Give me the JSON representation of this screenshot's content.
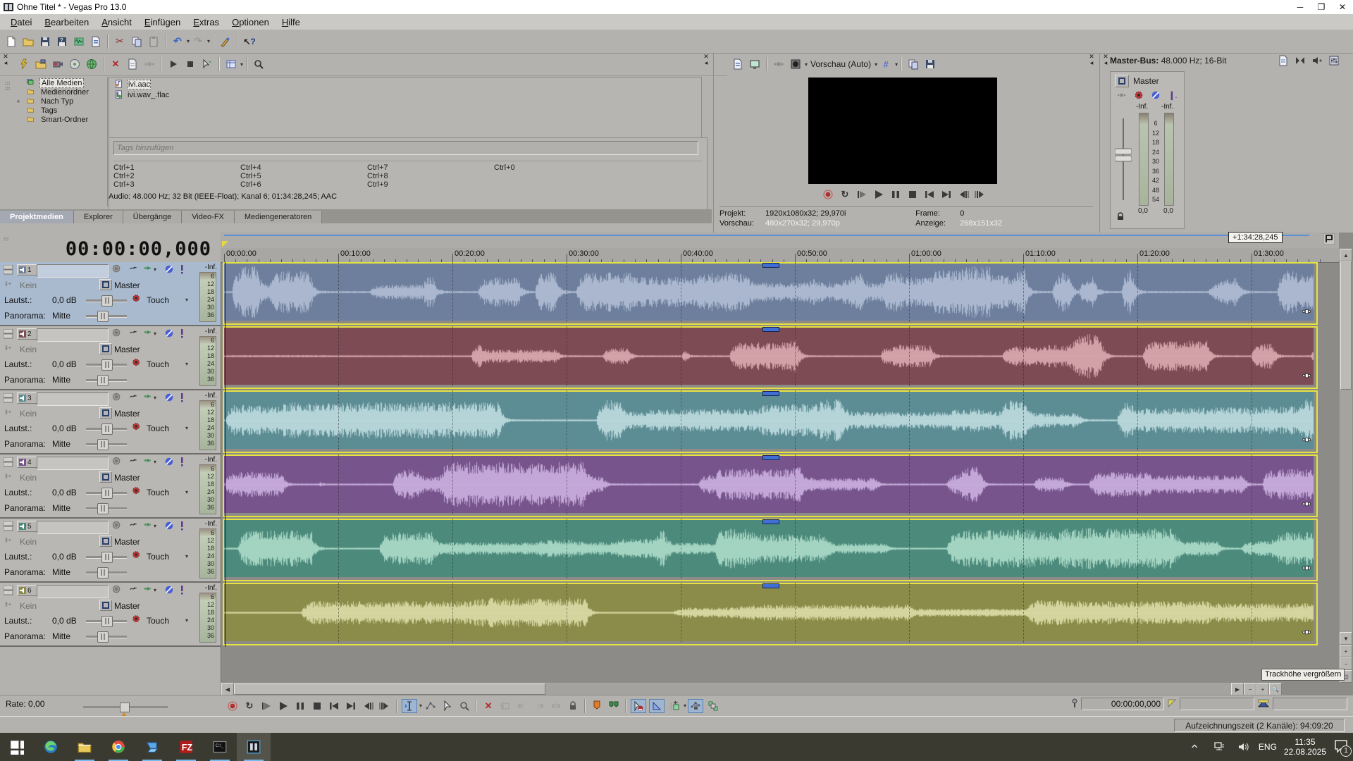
{
  "window": {
    "title": "Ohne Titel * - Vegas Pro 13.0",
    "minimize": "─",
    "maximize": "❐",
    "close": "✕"
  },
  "menu": {
    "items": [
      "Datei",
      "Bearbeiten",
      "Ansicht",
      "Einfügen",
      "Extras",
      "Optionen",
      "Hilfe"
    ]
  },
  "toolbar": {
    "icons": [
      "new-project-icon",
      "open-icon",
      "save-icon",
      "save-as-icon",
      "render-icon",
      "project-properties-icon",
      "|",
      "cut-icon",
      "copy-icon",
      "paste-icon",
      "|",
      "undo-icon",
      "caret",
      "redo-icon",
      "caret",
      "|",
      "interactive-tool-icon",
      "|",
      "help-cursor-icon"
    ]
  },
  "media": {
    "toolbar_icons": [
      "auto-preview-icon",
      "import-media-icon",
      "capture-video-icon",
      "extract-audio-icon",
      "get-media-web-icon",
      "|",
      "remove-media-icon",
      "media-properties-icon",
      "media-fx-icon",
      "|",
      "start-preview-icon",
      "stop-preview-icon",
      "hover-scrub-icon",
      "|",
      "views-icon",
      "caret",
      "|",
      "search-icon"
    ],
    "tree": [
      {
        "label": "Alle Medien",
        "icon": "all-media-icon",
        "selected": true,
        "expander": ""
      },
      {
        "label": "Medienordner",
        "icon": "folder-icon",
        "selected": false,
        "expander": ""
      },
      {
        "label": "Nach Typ",
        "icon": "folder-icon",
        "selected": false,
        "expander": "+"
      },
      {
        "label": "Tags",
        "icon": "folder-icon",
        "selected": false,
        "expander": ""
      },
      {
        "label": "Smart-Ordner",
        "icon": "folder-icon",
        "selected": false,
        "expander": ""
      }
    ],
    "files": [
      {
        "name": "ivi.aac",
        "icon": "audio-file-icon",
        "selected": true
      },
      {
        "name": "ivi.wav_.flac",
        "icon": "audio-file-green-icon",
        "selected": false
      }
    ],
    "tags_placeholder": "Tags hinzufügen",
    "shortcuts": [
      "Ctrl+1",
      "Ctrl+4",
      "Ctrl+7",
      "Ctrl+0",
      "Ctrl+2",
      "Ctrl+5",
      "Ctrl+8",
      "",
      "Ctrl+3",
      "Ctrl+6",
      "Ctrl+9",
      ""
    ],
    "info": "Audio: 48.000 Hz; 32 Bit (IEEE-Float); Kanal 6; 01:34:28,245; AAC",
    "tabs": [
      {
        "label": "Projektmedien",
        "active": true
      },
      {
        "label": "Explorer",
        "active": false
      },
      {
        "label": "Übergänge",
        "active": false
      },
      {
        "label": "Video-FX",
        "active": false
      },
      {
        "label": "Mediengeneratoren",
        "active": false
      }
    ]
  },
  "preview": {
    "toolbar_icons": [
      "project-properties-icon",
      "external-monitor-icon",
      "|",
      "video-fx-icon",
      "split-screen-icon",
      "caret"
    ],
    "mode_label": "Vorschau (Auto)",
    "after_icons": [
      "caret",
      "grid-overlay-icon",
      "caret",
      "|",
      "copy-frame-icon",
      "save-frame-icon"
    ],
    "transport_icons": [
      "record-icon",
      "loop-icon",
      "play-from-start-icon",
      "play-icon",
      "pause-icon",
      "stop-icon",
      "go-start-icon",
      "go-end-icon",
      "prev-frame-icon",
      "next-frame-icon"
    ],
    "info": {
      "projekt_label": "Projekt:",
      "projekt_value": "1920x1080x32; 29,970i",
      "vorschau_label": "Vorschau:",
      "vorschau_value": "480x270x32; 29,970p",
      "frame_label": "Frame:",
      "frame_value": "0",
      "anzeige_label": "Anzeige:",
      "anzeige_value": "268x151x32"
    }
  },
  "master": {
    "title_label": "Master-Bus:",
    "title_value": "48.000 Hz; 16-Bit",
    "toolbar_icons": [
      "bus-properties-icon",
      "downmix-icon",
      "dim-output-icon",
      "mixer-console-icon"
    ],
    "channel_label": "Master",
    "channel_icons": [
      "bus-fx-icon",
      "automation-gear-icon",
      "mute-icon",
      "solo-icon"
    ],
    "meter_top": [
      "-Inf.",
      "-Inf."
    ],
    "meter_scale": [
      "6",
      "12",
      "18",
      "24",
      "30",
      "36",
      "42",
      "48",
      "54"
    ],
    "meter_bottom": [
      "0,0",
      "0,0"
    ],
    "accent_blue": "#5b8fd6"
  },
  "timeline": {
    "timer": "00:00:00,000",
    "ruler_labels": [
      "00:00:00",
      "00:10:00",
      "00:20:00",
      "00:30:00",
      "00:40:00",
      "00:50:00",
      "01:00:00",
      "01:10:00",
      "01:20:00",
      "01:30:00"
    ],
    "loop_label": "+1:34:28,245",
    "tooltip": "Trackhöhe vergrößern"
  },
  "track_common": {
    "input_value": "Kein",
    "bus_value": "Master",
    "volume_label": "Lautst.:",
    "volume_value": "0,0 dB",
    "automation_mode": "Touch",
    "pan_label": "Panorama:",
    "pan_value": "Mitte",
    "meter_top": "-Inf.",
    "meter_scale": [
      "6",
      "12",
      "18",
      "24",
      "30",
      "36"
    ]
  },
  "tracks": [
    {
      "num": "1",
      "event_color": "#6d7f9d",
      "wave_color": "#b0bed4",
      "selected": true
    },
    {
      "num": "2",
      "event_color": "#7d4b53",
      "wave_color": "#daabb0",
      "selected": false
    },
    {
      "num": "3",
      "event_color": "#5d8d94",
      "wave_color": "#bedcdf",
      "selected": false
    },
    {
      "num": "4",
      "event_color": "#77558c",
      "wave_color": "#cbb0e0",
      "selected": false
    },
    {
      "num": "5",
      "event_color": "#4c8a7c",
      "wave_color": "#addac9",
      "selected": false
    },
    {
      "num": "6",
      "event_color": "#8c8c4a",
      "wave_color": "#dbdba8",
      "selected": false
    }
  ],
  "tools": {
    "icons": [
      "edit-tool-icon",
      "caret",
      "envelope-tool-icon",
      "selection-tool-icon",
      "zoom-tool-icon",
      "|",
      "delete-icon",
      "trim-icon",
      "split-left-icon",
      "split-right-icon",
      "split-both-icon",
      "lock-icon",
      "|",
      "marker-icon",
      "region-icon",
      "|",
      "snap-icon",
      "quantize-icon",
      "ripple-icon",
      "caret",
      "env-lock-icon",
      "group-ignore-icon"
    ]
  },
  "bottom": {
    "rate_label": "Rate: 0,00",
    "cursor_position": "00:00:00,000"
  },
  "status": {
    "recording_time": "Aufzeichnungszeit (2 Kanäle): 94:09:20"
  },
  "taskbar": {
    "app_icons": [
      "start-icon",
      "edge-icon",
      "explorer-icon",
      "chrome-icon",
      "remote-pc-icon",
      "filezilla-icon",
      "terminal-icon",
      "vegas-icon"
    ],
    "tray_icons": [
      "tray-chevron-icon",
      "network-icon",
      "speaker-icon"
    ],
    "lang": "ENG",
    "time": "11:35",
    "date": "22.08.2025",
    "notification_badge": "1"
  }
}
